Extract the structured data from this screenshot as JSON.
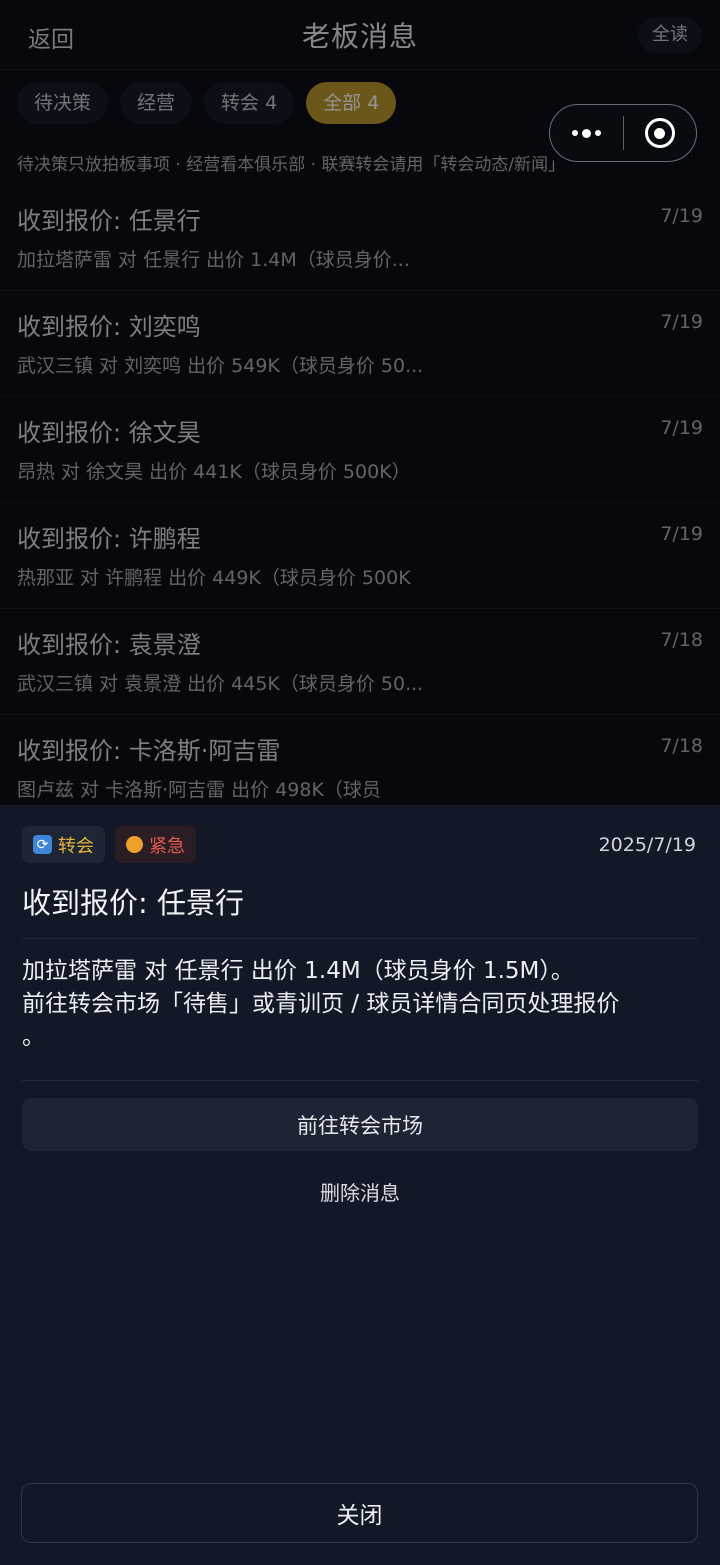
{
  "header": {
    "back_label": "返回",
    "title": "老板消息",
    "read_all_label": "全读"
  },
  "tabs": [
    {
      "label": "待决策",
      "active": false
    },
    {
      "label": "经营",
      "active": false
    },
    {
      "label": "转会 4",
      "active": false
    },
    {
      "label": "全部 4",
      "active": true
    }
  ],
  "hint": "待决策只放拍板事项 · 经营看本俱乐部 · 联赛转会请用「转会动态/新闻」",
  "messages": [
    {
      "title": "收到报价: 任景行",
      "date": "7/19",
      "summary": "加拉塔萨雷 对 任景行 出价 1.4M（球员身价..."
    },
    {
      "title": "收到报价: 刘奕鸣",
      "date": "7/19",
      "summary": "武汉三镇 对 刘奕鸣 出价 549K（球员身价 50..."
    },
    {
      "title": "收到报价: 徐文昊",
      "date": "7/19",
      "summary": "昂热 对 徐文昊 出价 441K（球员身价 500K）"
    },
    {
      "title": "收到报价: 许鹏程",
      "date": "7/19",
      "summary": "热那亚 对 许鹏程 出价 449K（球员身价 500K"
    },
    {
      "title": "收到报价: 袁景澄",
      "date": "7/18",
      "summary": "武汉三镇 对 袁景澄 出价 445K（球员身价 50..."
    },
    {
      "title": "收到报价: 卡洛斯·阿吉雷",
      "date": "7/18",
      "summary": "图卢兹 对 卡洛斯·阿吉雷 出价 498K（球员"
    }
  ],
  "detail": {
    "tag_transfer": "转会",
    "tag_urgent": "紧急",
    "date": "2025/7/19",
    "title": "收到报价: 任景行",
    "body_line1": "加拉塔萨雷 对 任景行 出价 1.4M（球员身价 1.5M）。",
    "body_line2": "前往转会市场「待售」或青训页 / 球员详情合同页处理报价",
    "body_line3": "。",
    "go_market_label": "前往转会市场",
    "delete_label": "删除消息",
    "close_label": "关闭"
  },
  "colors": {
    "accent_gold": "#b8962d",
    "urgent_red": "#e05a4e",
    "transfer_gold": "#e3b43c"
  }
}
